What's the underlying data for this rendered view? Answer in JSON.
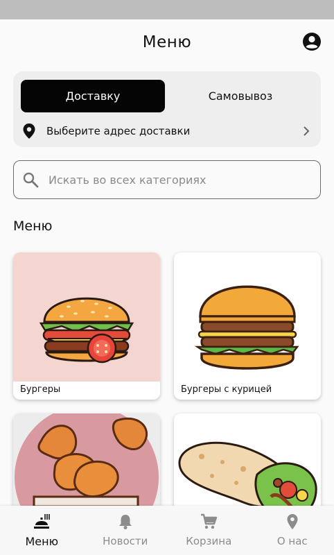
{
  "header": {
    "title": "Меню"
  },
  "delivery": {
    "tabs": [
      {
        "label": "Доставку",
        "active": true
      },
      {
        "label": "Самовывоз",
        "active": false
      }
    ],
    "address_prompt": "Выберите адрес доставки"
  },
  "search": {
    "placeholder": "Искать во всех категориях",
    "value": ""
  },
  "menu": {
    "title": "Меню",
    "categories": [
      {
        "label": "Бургеры"
      },
      {
        "label": "Бургеры с курицей"
      },
      {
        "label": ""
      },
      {
        "label": ""
      }
    ]
  },
  "bottom_nav": [
    {
      "label": "Меню",
      "icon": "menu-food-icon",
      "active": true
    },
    {
      "label": "Новости",
      "icon": "bell-icon",
      "active": false
    },
    {
      "label": "Корзина",
      "icon": "cart-icon",
      "active": false
    },
    {
      "label": "О нас",
      "icon": "location-pin-icon",
      "active": false
    }
  ],
  "colors": {
    "accent": "#050505",
    "inactive": "#8c8c8c",
    "card_bg": "#eeeeee"
  }
}
